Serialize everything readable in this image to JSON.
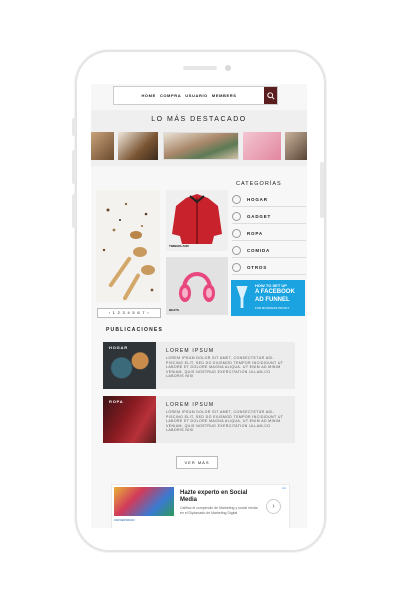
{
  "nav": {
    "links": [
      "HOME",
      "COMPRA",
      "USUARIO",
      "MEMBERS"
    ]
  },
  "featured": {
    "title": "LO MÁS DESTACADO"
  },
  "grid": {
    "jacket_label": "TIMBERLAND",
    "headphones_label": "BEATS",
    "pager": "‹ 1 2 3 4 5 6 7 ›"
  },
  "categories": {
    "title": "CATEGORÍAS",
    "items": [
      "HOGAR",
      "GADGET",
      "ROPA",
      "COMIDA",
      "OTROS"
    ]
  },
  "ad_small": {
    "line1": "HOW TO SET UP",
    "line2": "A FACEBOOK",
    "line3": "AD FUNNEL",
    "line4": "FOR BUSINESS PROFIT"
  },
  "publications": {
    "title": "PUBLICACIONES",
    "posts": [
      {
        "tag": "HOGAR",
        "title": "LOREM IPSUM",
        "text": "LOREM IPSUM DOLOR SIT AMET, CONSECTETUR ADI-PISCING ELIT, SED DO EIUSMOD TEMPOR INCIDIDUNT UT LABORE ET DOLORE MAGNA ALIQUA. UT ENIM AD MINIM VENIAM, QUIS NOSTRUD EXERCITATION ULLAM-CO LABORIS NISI"
      },
      {
        "tag": "ROPA",
        "title": "LOREM IPSUM",
        "text": "LOREM IPSUM DOLOR SIT AMET, CONSECTETUR ADI-PISCING ELIT, SED DO EIUSMOD TEMPOR INCIDIDUNT UT LABORE ET DOLORE MAGNA ALIQUA. UT ENIM AD MINIM VENIAM, QUIS NOSTRUD EXERCITATION ULLAM-CO LABORIS NISI"
      }
    ],
    "more": "VER MÁS"
  },
  "banner": {
    "title": "Hazte experto en Social Media",
    "text": "Califica el compendio de Marketing y social media en el Diplomado de Marketing Digital",
    "arrow": "›",
    "badge": "Ad",
    "brand": "UNIVERSIDAD"
  },
  "colors": {
    "search_button": "#5a1e1e",
    "ad_blue": "#1aa3e0",
    "jacket_red": "#c8232c",
    "headphones_pink": "#e8477f"
  }
}
